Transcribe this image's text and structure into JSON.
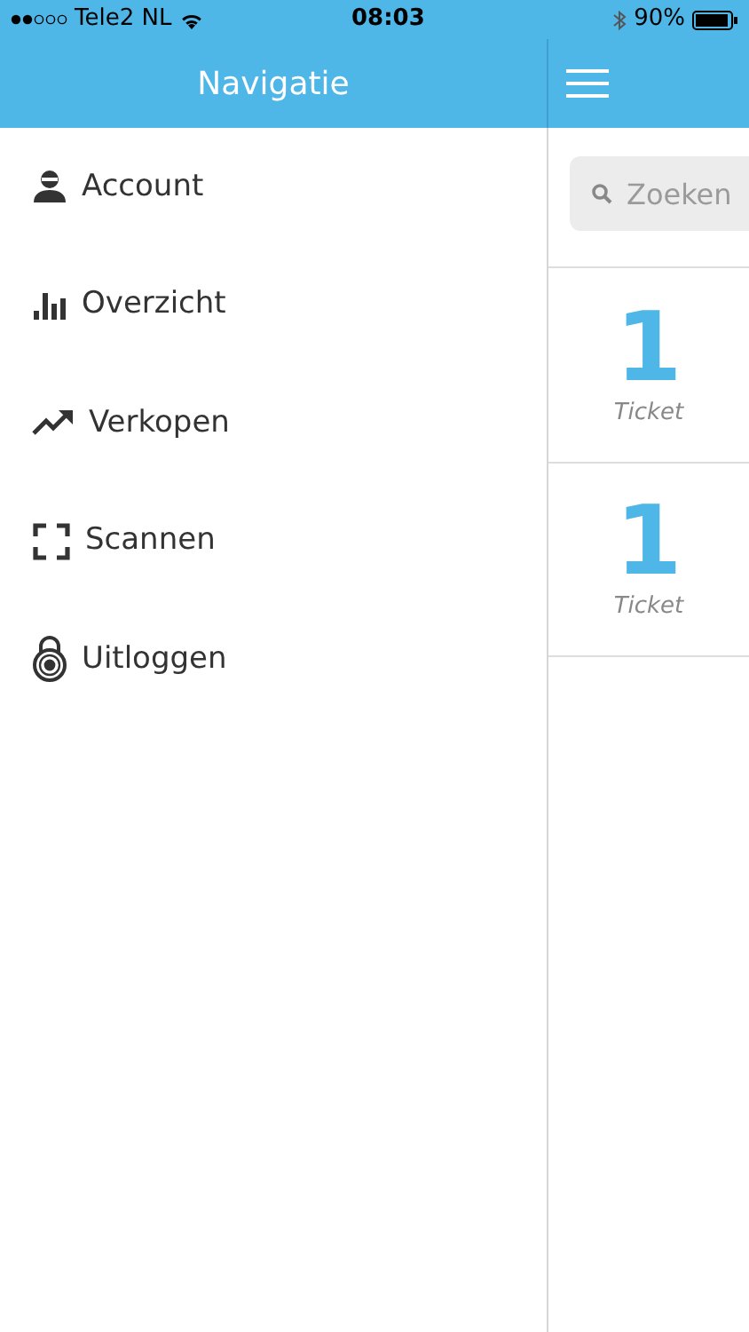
{
  "status_bar": {
    "carrier": "Tele2 NL",
    "time": "08:03",
    "battery": "90%"
  },
  "drawer": {
    "title": "Navigatie",
    "items": [
      {
        "label": "Account",
        "kind": "user"
      },
      {
        "label": "Overzicht",
        "kind": "bars"
      },
      {
        "label": "Verkopen",
        "kind": "trend"
      },
      {
        "label": "Scannen",
        "kind": "scan"
      },
      {
        "label": "Uitloggen",
        "kind": "lock"
      }
    ]
  },
  "main": {
    "search": {
      "placeholder": "Zoeken"
    },
    "cards": [
      {
        "count": "1",
        "unit": "Ticket"
      },
      {
        "count": "1",
        "unit": "Ticket"
      }
    ]
  }
}
